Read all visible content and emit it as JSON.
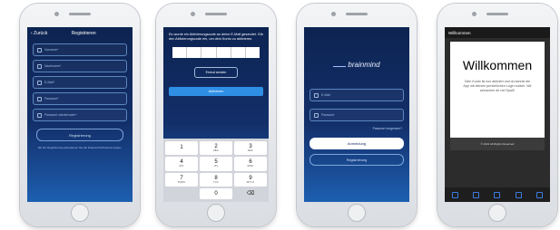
{
  "phone1": {
    "nav_back": "‹ Zurück",
    "nav_title": "Registrieren",
    "fields": [
      {
        "icon": "user-icon",
        "placeholder": "Vorname*"
      },
      {
        "icon": "user-icon",
        "placeholder": "Nachname*"
      },
      {
        "icon": "mail-icon",
        "placeholder": "E-Mail*"
      },
      {
        "icon": "lock-icon",
        "placeholder": "Passwort*"
      },
      {
        "icon": "lock-icon",
        "placeholder": "Passwort wiederholen*"
      }
    ],
    "register_button": "Registrierung",
    "terms_text": "Mit der Registrierung akzeptieren Sie die Datenschutzbestimmungen."
  },
  "phone2": {
    "info_text": "Es wurde ein Aktivierungscode an deine E-Mail gesendet. Gib den Aktivierungscode ein, um dein Konto zu aktivieren.",
    "resend_button": "Erneut senden",
    "activate_button": "Aktivieren",
    "keys": [
      {
        "num": "1",
        "letters": ""
      },
      {
        "num": "2",
        "letters": "ABC"
      },
      {
        "num": "3",
        "letters": "DEF"
      },
      {
        "num": "4",
        "letters": "GHI"
      },
      {
        "num": "5",
        "letters": "JKL"
      },
      {
        "num": "6",
        "letters": "MNO"
      },
      {
        "num": "7",
        "letters": "PQRS"
      },
      {
        "num": "8",
        "letters": "TUV"
      },
      {
        "num": "9",
        "letters": "WXYZ"
      },
      {
        "num": "",
        "letters": ""
      },
      {
        "num": "0",
        "letters": ""
      },
      {
        "num": "⌫",
        "letters": ""
      }
    ]
  },
  "phone3": {
    "logo_text": "brainmind",
    "email_placeholder": "E-Mail",
    "password_placeholder": "Passwort",
    "forgot_link": "Passwort vergessen?",
    "login_button": "Anmeldung",
    "register_button": "Registrierung"
  },
  "phone4": {
    "top_title": "Willkommen",
    "heading": "Willkommen",
    "body_text": "Dein Konto ist nun aktiviert und du kannst die App mit deinem persönlichen Login nutzen. Wir wünschen dir viel Spaß!",
    "copyright": "© 2021 All Rights Reserved",
    "tab_icons": [
      "home-icon",
      "calendar-icon",
      "chart-icon",
      "list-icon",
      "profile-icon"
    ]
  },
  "colors": {
    "bg_top": "#0d2452",
    "bg_bottom": "#1d5fb0",
    "accent": "#2f8fe5"
  }
}
